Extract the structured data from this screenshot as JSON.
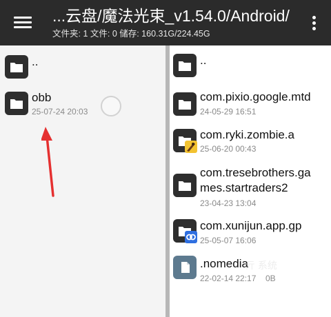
{
  "topbar": {
    "title": "...云盘/魔法光束_v1.54.0/Android/",
    "subtitle": "文件夹: 1  文件: 0  储存: 160.31G/224.45G"
  },
  "left_pane": {
    "items": [
      {
        "name": "..",
        "meta": "",
        "icon": "folder-icon"
      },
      {
        "name": "obb",
        "meta": "25-07-24 20:03",
        "icon": "folder-icon"
      }
    ]
  },
  "right_pane": {
    "items": [
      {
        "name": "..",
        "meta": "",
        "icon": "folder-icon"
      },
      {
        "name": "com.pixio.google.mtd",
        "meta": "24-05-29 16:51",
        "icon": "folder-icon"
      },
      {
        "name": "com.ryki.zombie.a",
        "meta": "25-06-20 00:43",
        "icon": "folder-icon",
        "badge": "zombie-app-icon"
      },
      {
        "name_line1": "com.tresebrothers.ga",
        "name_line2": "mes.startraders2",
        "meta": "23-04-23 13:04",
        "icon": "folder-icon"
      },
      {
        "name": "com.xunijun.app.gp",
        "meta": "25-05-07 16:06",
        "icon": "folder-icon",
        "badge": "link-app-icon"
      },
      {
        "name": ".nomedia",
        "meta": "22-02-14 22:17",
        "size": "0B",
        "icon": "file-icon"
      }
    ],
    "watermark": "亓 系统"
  },
  "colors": {
    "topbar": "#2b2b2b",
    "folder": "#2e2e2e",
    "arrow": "#e53030",
    "file": "#5d7a8f"
  }
}
